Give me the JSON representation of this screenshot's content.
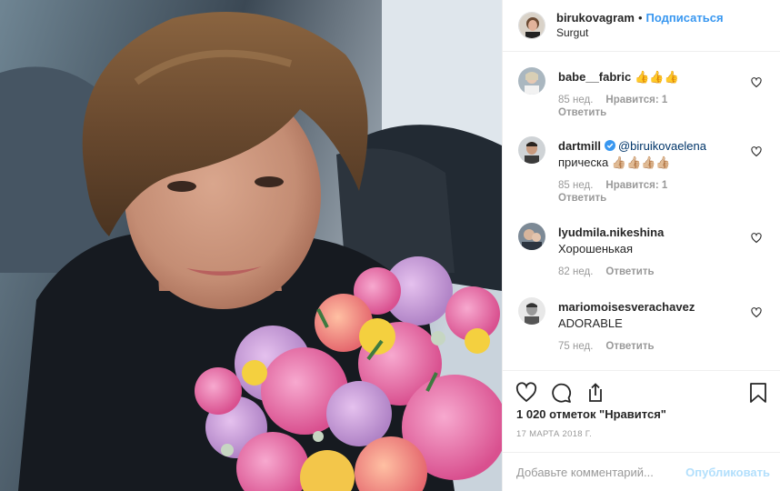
{
  "header": {
    "username": "birukovagram",
    "separator": "•",
    "follow_label": "Подписаться",
    "location": "Surgut"
  },
  "comments": [
    {
      "user": "babe__fabric",
      "text": "👍👍👍",
      "mention": "",
      "time": "85 нед.",
      "likes": "Нравится: 1",
      "reply": "Ответить"
    },
    {
      "user": "dartmill",
      "verified": true,
      "mention": "@biruikovaelena",
      "text": "прическа 👍🏼👍🏼👍🏼👍🏼",
      "time": "85 нед.",
      "likes": "Нравится: 1",
      "reply": "Ответить"
    },
    {
      "user": "lyudmila.nikeshina",
      "text": "Хорошенькая",
      "mention": "",
      "time": "82 нед.",
      "likes": "",
      "reply": "Ответить"
    },
    {
      "user": "mariomoisesverachavez",
      "text": "ADORABLE",
      "mention": "",
      "time": "75 нед.",
      "likes": "",
      "reply": "Ответить"
    }
  ],
  "actions": {
    "icons": [
      "heart-icon",
      "comment-icon",
      "share-icon",
      "bookmark-icon"
    ]
  },
  "likes_text": "1 020 отметок \"Нравится\"",
  "date_text": "17 МАРТА 2018 Г.",
  "add_comment": {
    "placeholder": "Добавьте комментарий...",
    "publish_label": "Опубликовать"
  },
  "colors": {
    "accent": "#3897f0",
    "publish_disabled": "#b2dffc",
    "muted": "#999999",
    "border": "#efefef"
  }
}
